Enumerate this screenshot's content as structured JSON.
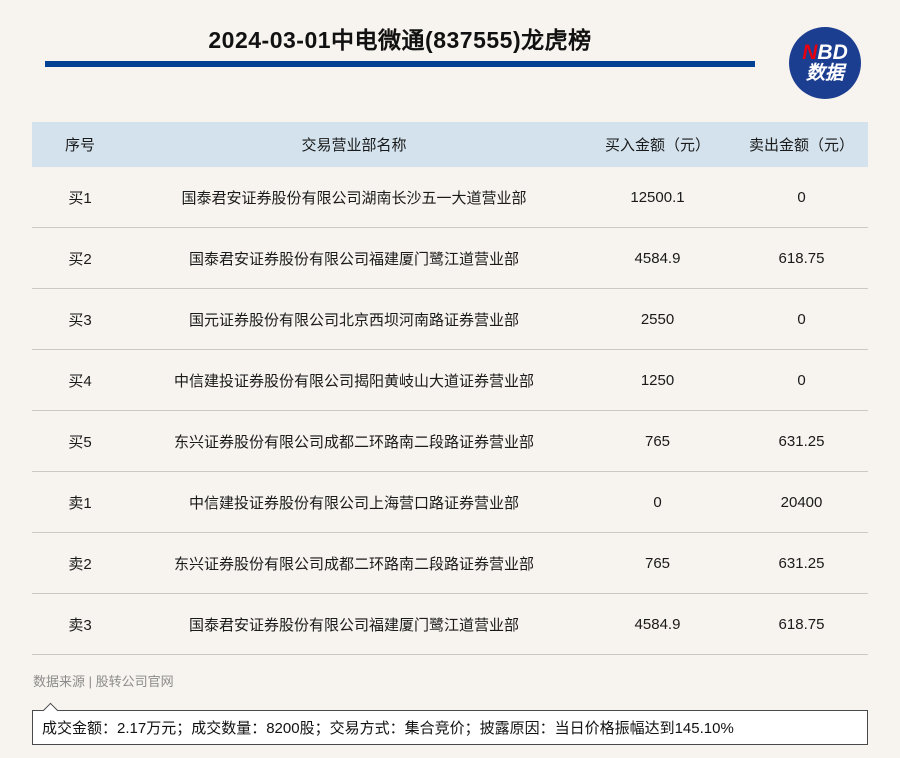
{
  "header": {
    "title": "2024-03-01中电微通(837555)龙虎榜",
    "logo": {
      "n": "N",
      "bd": "BD",
      "line2": "数据"
    }
  },
  "table": {
    "headers": [
      "序号",
      "交易营业部名称",
      "买入金额（元）",
      "卖出金额（元）"
    ],
    "rows": [
      [
        "买1",
        "国泰君安证券股份有限公司湖南长沙五一大道营业部",
        "12500.1",
        "0"
      ],
      [
        "买2",
        "国泰君安证券股份有限公司福建厦门鹭江道营业部",
        "4584.9",
        "618.75"
      ],
      [
        "买3",
        "国元证券股份有限公司北京西坝河南路证券营业部",
        "2550",
        "0"
      ],
      [
        "买4",
        "中信建投证券股份有限公司揭阳黄岐山大道证券营业部",
        "1250",
        "0"
      ],
      [
        "买5",
        "东兴证券股份有限公司成都二环路南二段路证券营业部",
        "765",
        "631.25"
      ],
      [
        "卖1",
        "中信建投证券股份有限公司上海营口路证券营业部",
        "0",
        "20400"
      ],
      [
        "卖2",
        "东兴证券股份有限公司成都二环路南二段路证券营业部",
        "765",
        "631.25"
      ],
      [
        "卖3",
        "国泰君安证券股份有限公司福建厦门鹭江道营业部",
        "4584.9",
        "618.75"
      ]
    ]
  },
  "footer": {
    "source": "数据来源 | 股转公司官网",
    "summary": "成交金额：2.17万元；成交数量：8200股；交易方式：集合竞价；披露原因：当日价格振幅达到145.10%"
  },
  "colors": {
    "page_bg": "#f7f3ee",
    "accent_blue": "#004191",
    "logo_blue": "#1c3e91",
    "logo_red": "#e60012",
    "header_row_bg": "#d3e2ec",
    "row_divider": "#ccc9c3",
    "source_gray": "#8c8c8c"
  },
  "chart_data": {
    "type": "table",
    "title": "2024-03-01中电微通(837555)龙虎榜",
    "columns": [
      "序号",
      "交易营业部名称",
      "买入金额（元）",
      "卖出金额（元）"
    ],
    "rows": [
      {
        "seq": "买1",
        "branch": "国泰君安证券股份有限公司湖南长沙五一大道营业部",
        "buy": 12500.1,
        "sell": 0
      },
      {
        "seq": "买2",
        "branch": "国泰君安证券股份有限公司福建厦门鹭江道营业部",
        "buy": 4584.9,
        "sell": 618.75
      },
      {
        "seq": "买3",
        "branch": "国元证券股份有限公司北京西坝河南路证券营业部",
        "buy": 2550,
        "sell": 0
      },
      {
        "seq": "买4",
        "branch": "中信建投证券股份有限公司揭阳黄岐山大道证券营业部",
        "buy": 1250,
        "sell": 0
      },
      {
        "seq": "买5",
        "branch": "东兴证券股份有限公司成都二环路南二段路证券营业部",
        "buy": 765,
        "sell": 631.25
      },
      {
        "seq": "卖1",
        "branch": "中信建投证券股份有限公司上海营口路证券营业部",
        "buy": 0,
        "sell": 20400
      },
      {
        "seq": "卖2",
        "branch": "东兴证券股份有限公司成都二环路南二段路证券营业部",
        "buy": 765,
        "sell": 631.25
      },
      {
        "seq": "卖3",
        "branch": "国泰君安证券股份有限公司福建厦门鹭江道营业部",
        "buy": 4584.9,
        "sell": 618.75
      }
    ],
    "notes": {
      "成交金额": "2.17万元",
      "成交数量": "8200股",
      "交易方式": "集合竞价",
      "披露原因": "当日价格振幅达到145.10%"
    }
  }
}
